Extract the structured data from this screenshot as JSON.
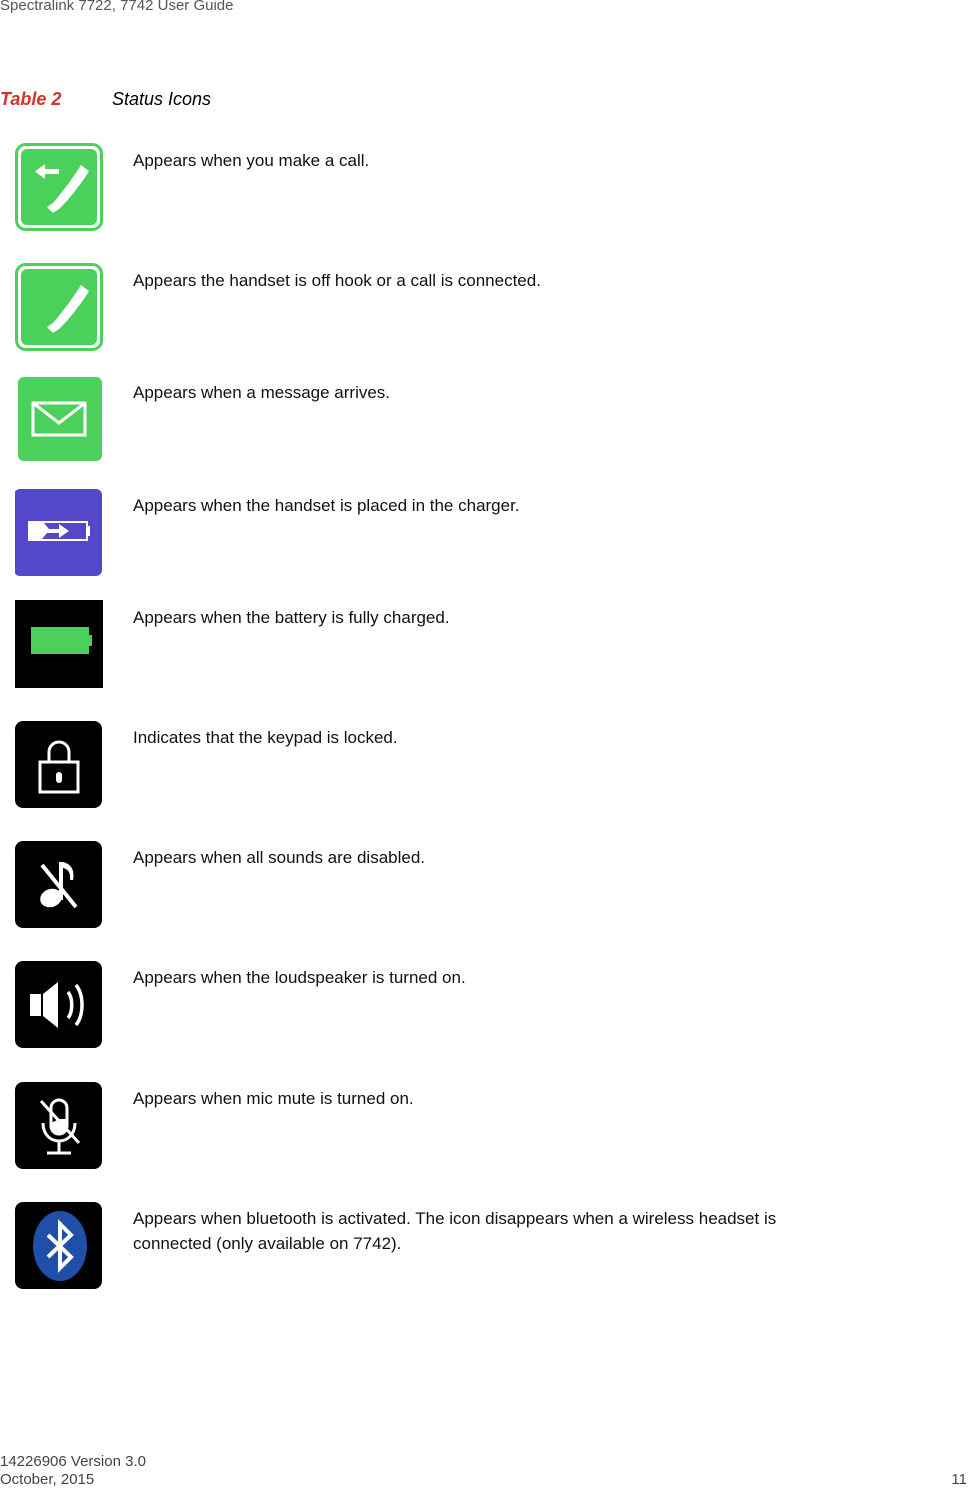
{
  "header": {
    "title": "Spectralink 7722, 7742  User Guide"
  },
  "table": {
    "number_label": "Table 2",
    "title": "Status Icons",
    "rows": [
      {
        "icon": "outgoing-call-icon",
        "description": "Appears when you make a call."
      },
      {
        "icon": "off-hook-icon",
        "description": "Appears the handset is off hook or a call is connected."
      },
      {
        "icon": "message-icon",
        "description": "Appears when a message arrives."
      },
      {
        "icon": "charging-icon",
        "description": "Appears when the handset is placed in the charger."
      },
      {
        "icon": "battery-full-icon",
        "description": "Appears when the battery is fully charged."
      },
      {
        "icon": "keypad-lock-icon",
        "description": "Indicates that the keypad is locked."
      },
      {
        "icon": "sounds-disabled-icon",
        "description": "Appears when all sounds are disabled."
      },
      {
        "icon": "loudspeaker-icon",
        "description": "Appears when the loudspeaker is turned on."
      },
      {
        "icon": "mic-mute-icon",
        "description": "Appears when mic mute is turned on."
      },
      {
        "icon": "bluetooth-icon",
        "description": "Appears when bluetooth is activated. The icon disappears when a wireless headset is connected (only available on 7742)."
      }
    ]
  },
  "colors": {
    "green": "#4cd05c",
    "purple": "#5447c9",
    "black": "#000000",
    "bluetooth_blue": "#1f4fa8",
    "caption_red": "#d2332b"
  },
  "footer": {
    "doc_version": "14226906 Version 3.0",
    "date": "October, 2015",
    "page_number": "11"
  }
}
